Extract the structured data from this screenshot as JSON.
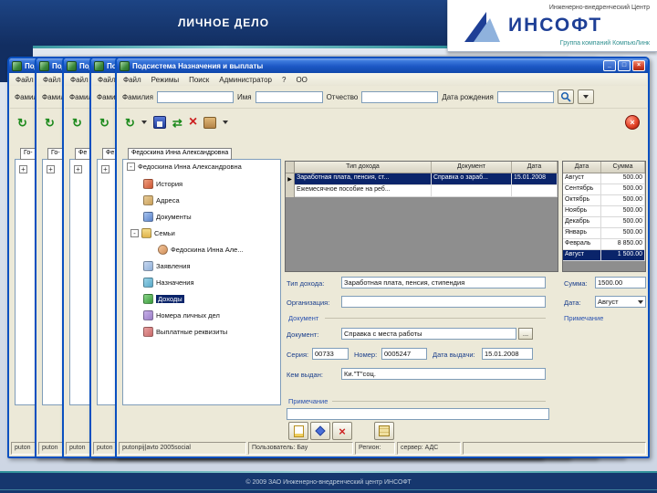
{
  "page": {
    "header_title": "ЛИЧНОЕ ДЕЛО",
    "logo_top": "Инженерно-внедренческий Центр",
    "logo_name": "ИНСОФТ",
    "logo_bottom": "Группа компаний КомпьюЛинк",
    "footer_copyright": "© 2009 ЗАО Инженерно-внедренческий центр ИНСОФТ",
    "colors": {
      "header_navy": "#16376e",
      "accent_teal": "#3fa0a8",
      "logo_blue": "#1e3f96",
      "selection_navy": "#0a246a"
    }
  },
  "bg": {
    "title": "Подсистема Назначения и выплаты",
    "menu_file": "Файл",
    "surname_label": "Фамилия",
    "status": "puton",
    "windows": [
      {
        "tab_fragment": "Го-"
      },
      {
        "tab_fragment": "Го-"
      },
      {
        "tab_fragment": "Фе"
      },
      {
        "tab_fragment": "Фе"
      }
    ]
  },
  "window": {
    "title": "Подсистема Назначения и выплаты",
    "controls": {
      "minimize": "_",
      "maximize": "□",
      "close": "×"
    },
    "menu": [
      "Файл",
      "Режимы",
      "Поиск",
      "Администратор",
      "?",
      "ОО"
    ],
    "search": {
      "surname": "Фамилия",
      "name": "Имя",
      "patronymic": "Отчество",
      "birthdate": "Дата рождения"
    },
    "person_tab": "Федоскина Инна Александровна",
    "tree": {
      "root": "Федоскина Инна Александровна",
      "items": [
        {
          "label": "История"
        },
        {
          "label": "Адреса"
        },
        {
          "label": "Документы"
        },
        {
          "label": "Семьи"
        },
        {
          "label": "Федоскина Инна Але...",
          "child": true
        },
        {
          "label": "Заявления"
        },
        {
          "label": "Назначения"
        },
        {
          "label": "Доходы",
          "selected": true
        },
        {
          "label": "Номера личных дел"
        },
        {
          "label": "Выплатные реквизиты"
        }
      ]
    },
    "income_grid": {
      "headers": [
        "Тип дохода",
        "Документ",
        "Дата"
      ],
      "rows": [
        {
          "type": "Заработная плата, пенсия, ст...",
          "doc": "Справка о зараб...",
          "date": "15.01.2008"
        },
        {
          "type": "Ежемесячное пособие на реб...",
          "doc": "",
          "date": ""
        }
      ]
    },
    "amount_grid": {
      "headers": [
        "Дата",
        "Сумма"
      ],
      "rows": [
        {
          "month": "Август",
          "sum": "500.00"
        },
        {
          "month": "Сентябрь",
          "sum": "500.00"
        },
        {
          "month": "Октябрь",
          "sum": "500.00"
        },
        {
          "month": "Ноябрь",
          "sum": "500.00"
        },
        {
          "month": "Декабрь",
          "sum": "500.00"
        },
        {
          "month": "Январь",
          "sum": "500.00"
        },
        {
          "month": "Февраль",
          "sum": "8 850.00"
        },
        {
          "month": "Август",
          "sum": "1 500.00"
        }
      ]
    },
    "form": {
      "income_type_label": "Тип дохода:",
      "income_type_value": "Заработная плата, пенсия, стипендия",
      "organization_label": "Организация:",
      "organization_value": "",
      "document_group_label": "Документ",
      "document_label": "Документ:",
      "document_value": "Справка с места работы",
      "browse_button": "...",
      "series_label": "Серия:",
      "series_value": "00733",
      "number_label": "Номер:",
      "number_value": "0005247",
      "issue_date_label": "Дата выдачи:",
      "issue_date_value": "15.01.2008",
      "issuer_label": "Кем выдан:",
      "issuer_value": "Ки.\"Т\"соц.",
      "amount_label": "Сумма:",
      "amount_value": "1500.00",
      "date_label": "Дата:",
      "date_value": "Август",
      "note_group_label": "Примечание",
      "note_value": ""
    },
    "statusbar": {
      "path": "putonpij|avto 2005social",
      "user": "Пользователь: Бау",
      "region": "Регион:",
      "server": "сервер: АДС"
    }
  }
}
